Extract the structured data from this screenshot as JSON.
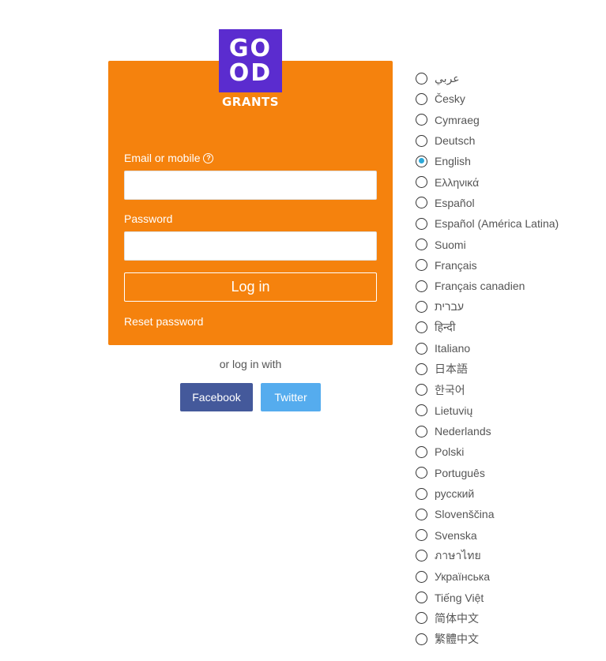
{
  "logo": {
    "line1": "GO",
    "line2": "OD",
    "word": "GRANTS",
    "color": "#5b2ccf"
  },
  "login_form": {
    "email_label": "Email or mobile",
    "email_help_icon": "question-circle-icon",
    "email_value": "",
    "password_label": "Password",
    "password_value": "",
    "login_button": "Log in",
    "reset_link": "Reset password",
    "background_color": "#f5820d"
  },
  "social": {
    "or_text": "or log in with",
    "facebook": "Facebook",
    "twitter": "Twitter"
  },
  "languages": {
    "selected": "English",
    "items": [
      "عربي",
      "Česky",
      "Cymraeg",
      "Deutsch",
      "English",
      "Ελληνικά",
      "Español",
      "Español (América Latina)",
      "Suomi",
      "Français",
      "Français canadien",
      "עברית",
      "हिन्दी",
      "Italiano",
      "日本語",
      "한국어",
      "Lietuvių",
      "Nederlands",
      "Polski",
      "Português",
      "русский",
      "Slovenščina",
      "Svenska",
      "ภาษาไทย",
      "Українська",
      "Tiếng Việt",
      "简体中文",
      "繁體中文"
    ]
  }
}
